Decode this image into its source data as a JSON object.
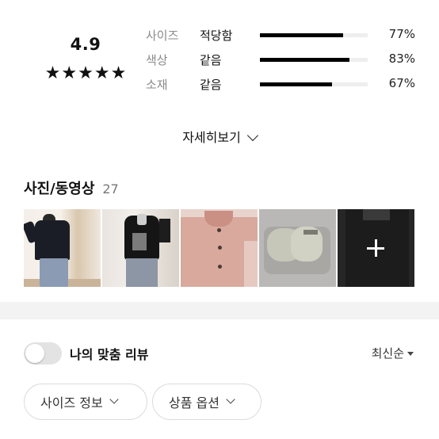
{
  "rating": {
    "score": "4.9",
    "stars": 5,
    "star_glyph": "★"
  },
  "fit": [
    {
      "attr": "사이즈",
      "verdict": "적당함",
      "percent": "77%",
      "fraction": 0.77
    },
    {
      "attr": "색상",
      "verdict": "같음",
      "percent": "83%",
      "fraction": 0.83
    },
    {
      "attr": "소재",
      "verdict": "같음",
      "percent": "67%",
      "fraction": 0.67
    }
  ],
  "more_label": "자세히보기",
  "photos": {
    "title": "사진/동영상",
    "count": "27",
    "more_icon": "plus-icon"
  },
  "my_fit_toggle": {
    "label": "나의 맞춤 리뷰",
    "on": false
  },
  "sort": {
    "label": "최신순"
  },
  "filters": [
    {
      "label": "사이즈 정보"
    },
    {
      "label": "상품 옵션"
    }
  ],
  "colors": {
    "accent": "#000000",
    "track": "#eeeeee",
    "muted": "#8a8a8a",
    "divider": "#f3f3f3"
  }
}
